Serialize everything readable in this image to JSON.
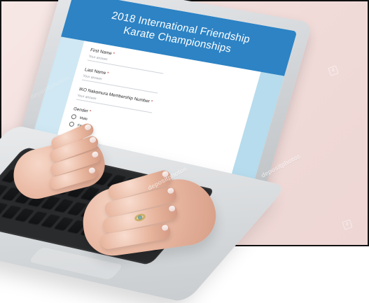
{
  "screen_form": {
    "title_line_1": "2018 International Friendship",
    "title_line_2": "Karate Championships",
    "fields": [
      {
        "label": "First Name",
        "required_mark": "*",
        "placeholder": "Your answer"
      },
      {
        "label": "Last Name",
        "required_mark": "*",
        "placeholder": "Your answer"
      },
      {
        "label": "IKO Nakamura Membership Number",
        "required_mark": "*",
        "placeholder": "Your answer"
      }
    ],
    "gender": {
      "label": "Gender",
      "required_mark": "*",
      "options": [
        "Male",
        "Female"
      ]
    }
  },
  "watermarks": {
    "brand_1": "depositphotos",
    "brand_2": "depositphotos",
    "brand_3": "depositphotos",
    "small_logo_1": "d",
    "small_logo_2": "d"
  },
  "colors": {
    "header_blue": "#2d83c4",
    "side_band_light_blue": "#a9d6ea",
    "keyboard_black": "#2a2b2d",
    "background_pink": "#f1dcda"
  }
}
